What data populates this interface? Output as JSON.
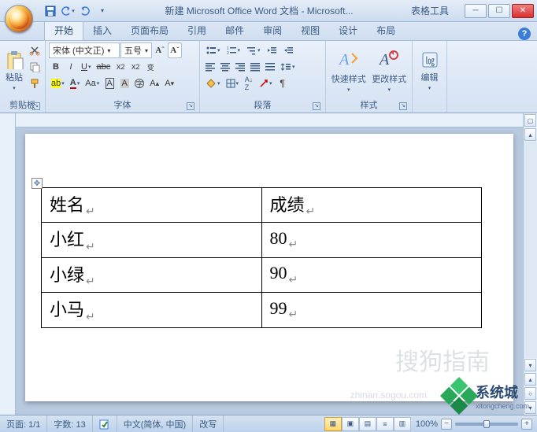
{
  "window": {
    "title": "新建 Microsoft Office Word 文档 - Microsoft...",
    "context_tools": "表格工具"
  },
  "tabs": {
    "t0": "开始",
    "t1": "插入",
    "t2": "页面布局",
    "t3": "引用",
    "t4": "邮件",
    "t5": "审阅",
    "t6": "视图",
    "t7": "设计",
    "t8": "布局"
  },
  "ribbon": {
    "clipboard": {
      "title": "剪贴板",
      "paste": "粘贴"
    },
    "font": {
      "title": "字体",
      "family": "宋体 (中文正)",
      "size": "五号"
    },
    "paragraph": {
      "title": "段落"
    },
    "styles": {
      "title": "样式",
      "quick": "快速样式",
      "change": "更改样式"
    },
    "editing": {
      "title": "编辑"
    }
  },
  "document": {
    "table": {
      "headers": [
        "姓名",
        "成绩"
      ],
      "rows": [
        [
          "小红",
          "80"
        ],
        [
          "小绿",
          "90"
        ],
        [
          "小马",
          "99"
        ]
      ]
    }
  },
  "status": {
    "page": "页面: 1/1",
    "words": "字数: 13",
    "lang": "中文(简体, 中国)",
    "mode": "改写",
    "zoom": "100%"
  },
  "watermark": {
    "brand": "系统城",
    "url": "xitongcheng.com",
    "faint": "搜狗指南",
    "faint2": "zhinan.sogou.com"
  }
}
